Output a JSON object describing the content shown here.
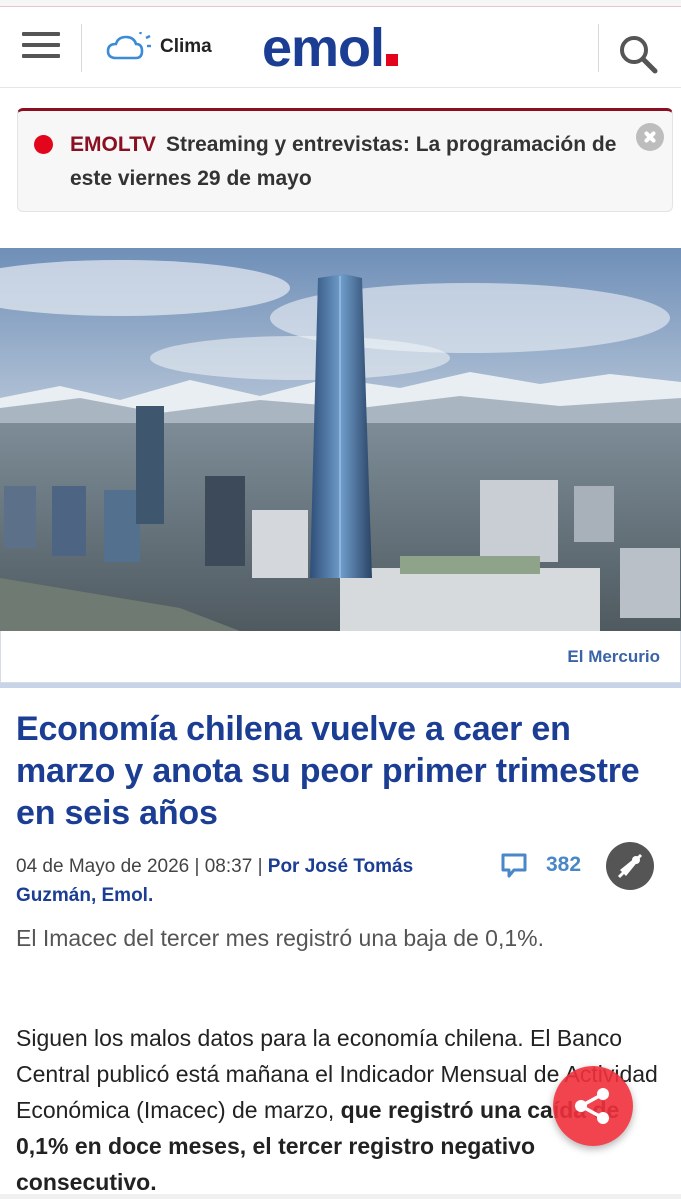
{
  "header": {
    "clima_label": "Clima",
    "logo_text": "emol"
  },
  "banner": {
    "tag": "EMOLTV",
    "message": "Streaming y entrevistas: La programación de este viernes 29 de mayo"
  },
  "photo": {
    "credit": "El Mercurio"
  },
  "article": {
    "headline": "Economía chilena vuelve a caer en marzo y anota su peor primer trimestre en seis años",
    "date": "04 de Mayo de 2026 | 08:37 |",
    "author": "Por José Tomás Guzmán, Emol.",
    "comments_count": "382",
    "subtitle": "El Imacec del tercer mes registró una baja de 0,1%.",
    "body_plain": "Siguen los malos datos para la economía chilena. El Banco Central publicó está mañana el Indicador Mensual de Actividad Económica (Imacec) de marzo,",
    "body_bold": "que registró una caída de 0,1% en doce meses, el tercer registro negativo consecutivo."
  },
  "colors": {
    "brand_blue": "#1b3e94",
    "brand_red": "#e3051b",
    "banner_accent": "#8a1021",
    "link_blue": "#4a87c8",
    "share_red": "#f0303c"
  },
  "icons": {
    "menu": "hamburger-icon",
    "weather": "cloud-sun-icon",
    "search": "search-icon",
    "close": "close-icon",
    "comments": "comment-bubble-icon",
    "audio": "audio-off-icon",
    "share": "share-icon"
  }
}
